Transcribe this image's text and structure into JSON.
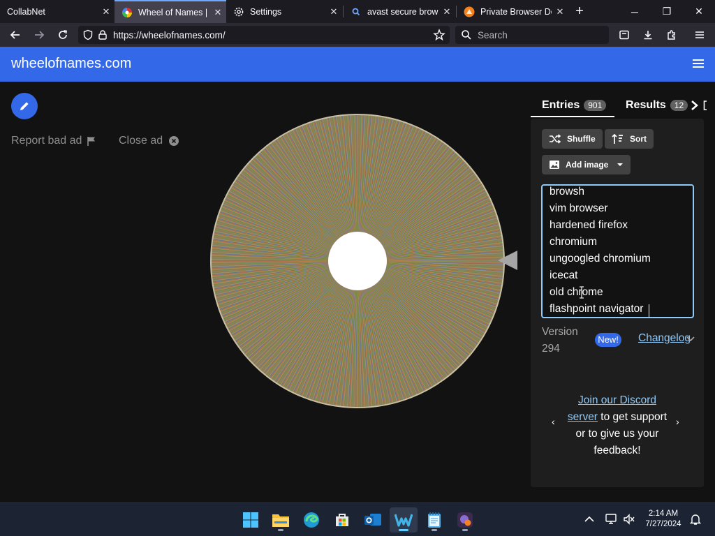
{
  "browser": {
    "tabs": [
      {
        "title": "CollabNet",
        "active": false
      },
      {
        "title": "Wheel of Names | R",
        "active": true
      },
      {
        "title": "Settings",
        "active": false
      },
      {
        "title": "avast secure browse",
        "active": false
      },
      {
        "title": "Private Browser Do",
        "active": false
      }
    ],
    "url": "https://wheelofnames.com/",
    "search_placeholder": "Search"
  },
  "site": {
    "title": "wheelofnames.com",
    "report_ad": "Report bad ad",
    "close_ad": "Close ad"
  },
  "panel": {
    "tabs": [
      {
        "label": "Entries",
        "count": "901"
      },
      {
        "label": "Results",
        "count": "12"
      }
    ],
    "buttons": {
      "shuffle": "Shuffle",
      "sort": "Sort",
      "add_image": "Add image"
    },
    "entries": [
      "browsh",
      "vim browser",
      "hardened firefox",
      "chromium",
      "ungoogled chromium",
      "icecat",
      "old chrome",
      "flashpoint navigator"
    ],
    "version_label": "Version 294",
    "new_badge": "New!",
    "changelog": "Changelog",
    "discord_link1": "Join our Discord",
    "discord_link2": "server",
    "discord_text1": "to get",
    "discord_text2": "support or to give us your feedback!"
  },
  "taskbar": {
    "time": "2:14 AM",
    "date": "7/27/2024"
  },
  "colors": {
    "accent": "#3369e8",
    "link": "#90caf9",
    "wheel_base": "#8f8060"
  }
}
